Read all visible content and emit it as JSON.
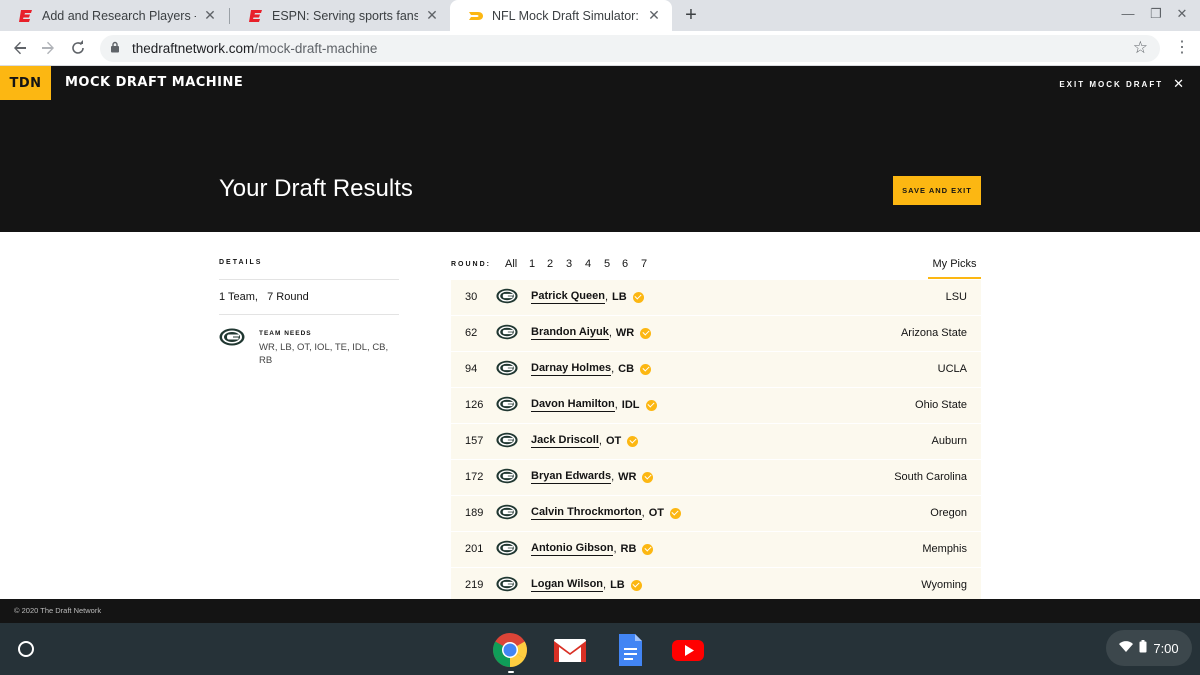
{
  "browser": {
    "tabs": [
      {
        "title": "Add and Research Players - Bask",
        "favicon": "espn-icon",
        "active": false
      },
      {
        "title": "ESPN: Serving sports fans. Anyti",
        "favicon": "espn-icon",
        "active": false
      },
      {
        "title": "NFL Mock Draft Simulator: Make",
        "favicon": "tdn-icon",
        "active": true
      }
    ],
    "url_host": "thedraftnetwork.com",
    "url_path": "/mock-draft-machine"
  },
  "header": {
    "logo": "TDN",
    "brand": "MOCK DRAFT MACHINE",
    "exit_label": "EXIT MOCK DRAFT",
    "title": "Your Draft Results",
    "save_button": "SAVE AND EXIT",
    "accent_color": "#fcb712"
  },
  "details": {
    "heading": "DETAILS",
    "teams": "1 Team,",
    "rounds": "7 Round",
    "needs_heading": "TEAM NEEDS",
    "needs": "WR, LB, OT, IOL, TE, IDL, CB, RB"
  },
  "rounds": {
    "label": "ROUND:",
    "items": [
      "All",
      "1",
      "2",
      "3",
      "4",
      "5",
      "6",
      "7"
    ],
    "my_picks": "My Picks"
  },
  "picks": [
    {
      "num": "30",
      "name": "Patrick Queen",
      "pos": "LB",
      "school": "LSU"
    },
    {
      "num": "62",
      "name": "Brandon Aiyuk",
      "pos": "WR",
      "school": "Arizona State"
    },
    {
      "num": "94",
      "name": "Darnay Holmes",
      "pos": "CB",
      "school": "UCLA"
    },
    {
      "num": "126",
      "name": "Davon Hamilton",
      "pos": "IDL",
      "school": "Ohio State"
    },
    {
      "num": "157",
      "name": "Jack Driscoll",
      "pos": "OT",
      "school": "Auburn"
    },
    {
      "num": "172",
      "name": "Bryan Edwards",
      "pos": "WR",
      "school": "South Carolina"
    },
    {
      "num": "189",
      "name": "Calvin Throckmorton",
      "pos": "OT",
      "school": "Oregon"
    },
    {
      "num": "201",
      "name": "Antonio Gibson",
      "pos": "RB",
      "school": "Memphis"
    },
    {
      "num": "219",
      "name": "Logan Wilson",
      "pos": "LB",
      "school": "Wyoming"
    }
  ],
  "footer": {
    "copyright": "© 2020 The Draft Network"
  },
  "shelf": {
    "apps": [
      "chrome-icon",
      "gmail-icon",
      "docs-icon",
      "youtube-icon"
    ],
    "time": "7:00"
  }
}
